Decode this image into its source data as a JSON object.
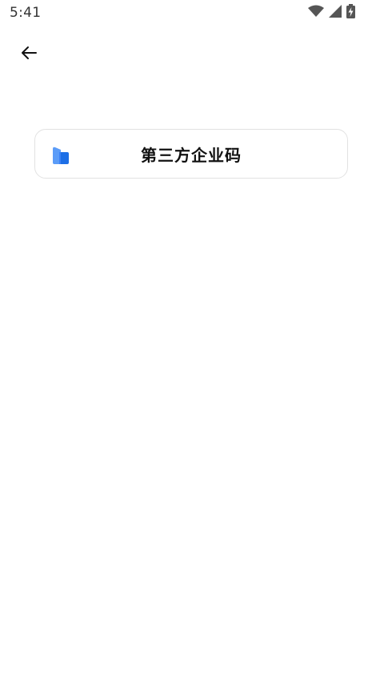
{
  "status_bar": {
    "time": "5:41",
    "icons": [
      "wifi-icon",
      "cellular-signal-icon",
      "battery-charging-icon"
    ]
  },
  "nav": {
    "back_icon": "arrow-left-icon"
  },
  "options": [
    {
      "label": "第三方企业码",
      "icon": "building-icon",
      "icon_color": "#3b82f6"
    }
  ],
  "colors": {
    "background": "#ffffff",
    "card_border": "#e2e2e2",
    "text": "#111111",
    "accent": "#3b82f6"
  }
}
